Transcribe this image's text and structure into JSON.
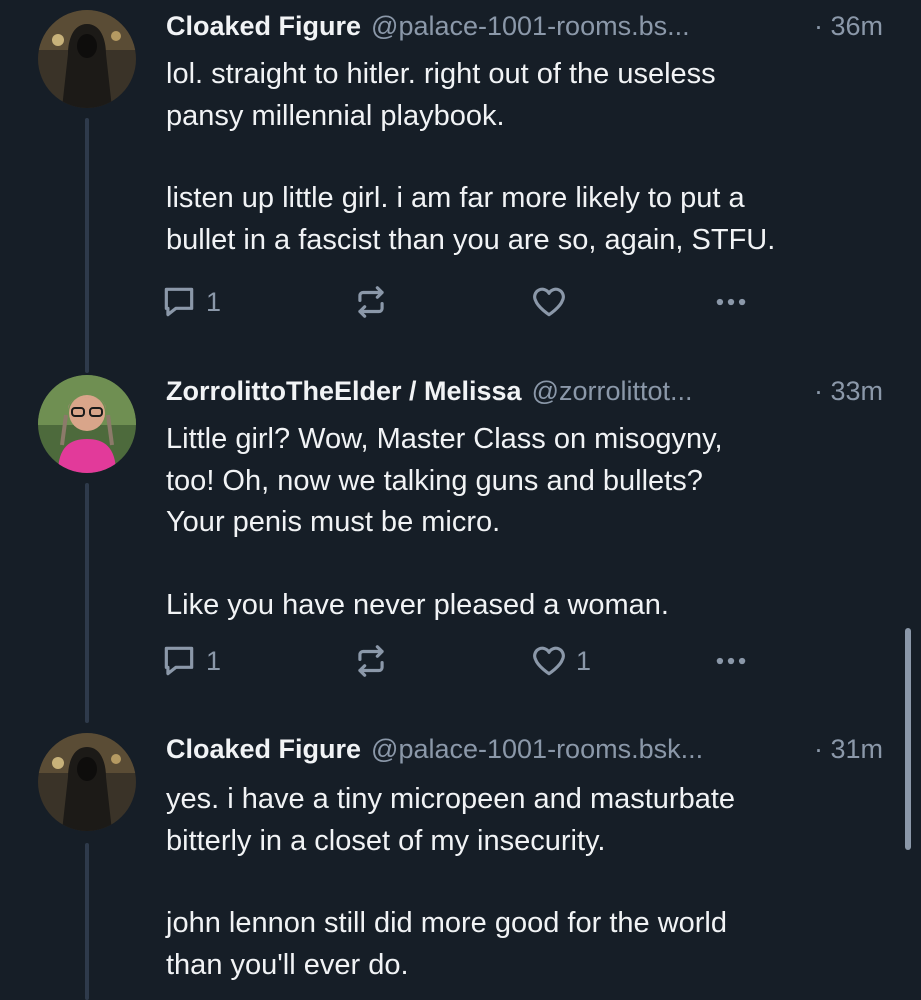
{
  "colors": {
    "background": "#161e27",
    "text": "#f1f3f5",
    "muted": "#8b98a9",
    "thread_line": "#2e3a4b"
  },
  "posts": [
    {
      "author_name": "Cloaked Figure",
      "handle": "@palace-1001-rooms.bs...",
      "time": "· 36m",
      "text_lines": [
        "lol. straight to hitler. right out of the useless\npansy millennial playbook.",
        "listen up little girl. i am far more likely to put a\nbullet in a fascist than you are so, again, STFU."
      ],
      "reply_count": "1",
      "repost_count": "",
      "like_count": "",
      "avatar_icon": "cloaked-figure-avatar"
    },
    {
      "author_name": "ZorrolittoTheElder / Melissa",
      "handle": "@zorrolittot...",
      "time": "· 33m",
      "text_lines": [
        "Little girl?  Wow, Master Class on misogyny,\ntoo!  Oh, now we talking guns and bullets?\nYour penis must be micro.",
        "Like you have never pleased a woman."
      ],
      "reply_count": "1",
      "repost_count": "",
      "like_count": "1",
      "avatar_icon": "woman-with-glasses-avatar"
    },
    {
      "author_name": "Cloaked Figure",
      "handle": "@palace-1001-rooms.bsk...",
      "time": "· 31m",
      "text_lines": [
        "yes. i have a tiny micropeen and masturbate\nbitterly in a closet of my insecurity.",
        "john lennon still did more good for the world\nthan you'll ever do."
      ],
      "reply_count": "",
      "repost_count": "",
      "like_count": "",
      "avatar_icon": "cloaked-figure-avatar"
    }
  ]
}
